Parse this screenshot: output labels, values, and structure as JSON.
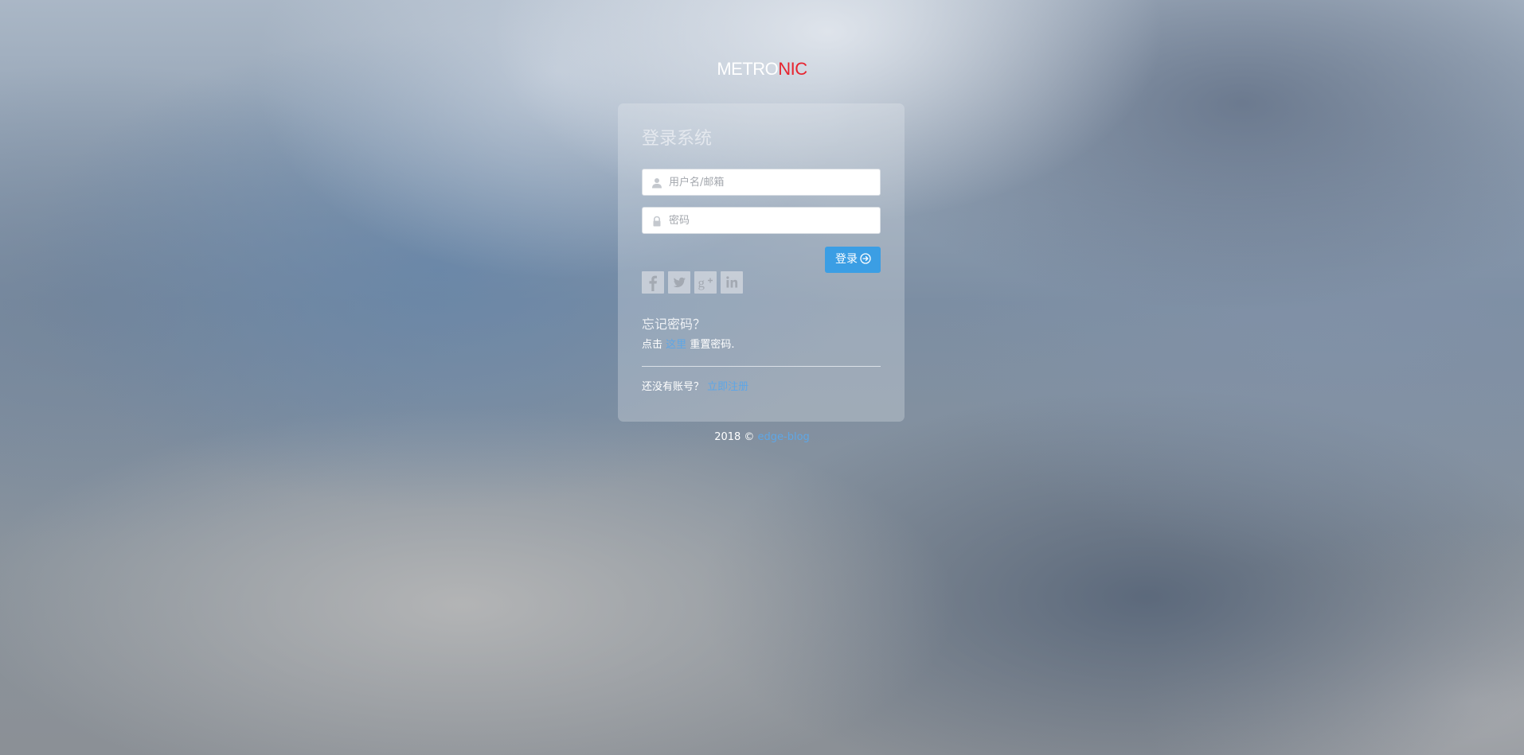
{
  "logo": {
    "part1": "METRO",
    "part2": "NIC"
  },
  "login": {
    "title": "登录系统",
    "username_placeholder": "用户名/邮箱",
    "password_placeholder": "密码",
    "submit_label": "登录"
  },
  "social": [
    {
      "icon": "facebook-icon"
    },
    {
      "icon": "twitter-icon"
    },
    {
      "icon": "googleplus-icon"
    },
    {
      "icon": "linkedin-icon"
    }
  ],
  "forget": {
    "title": "忘记密码？",
    "prefix": "点击",
    "link": "这里",
    "suffix": "重置密码."
  },
  "register": {
    "prefix": "还没有账号？",
    "link": "立即注册"
  },
  "footer": {
    "year": "2018 ©",
    "link": "edge-blog"
  },
  "colors": {
    "logo_accent": "#e7242f",
    "button": "#3b9ee4",
    "link": "#5ea6e6"
  }
}
